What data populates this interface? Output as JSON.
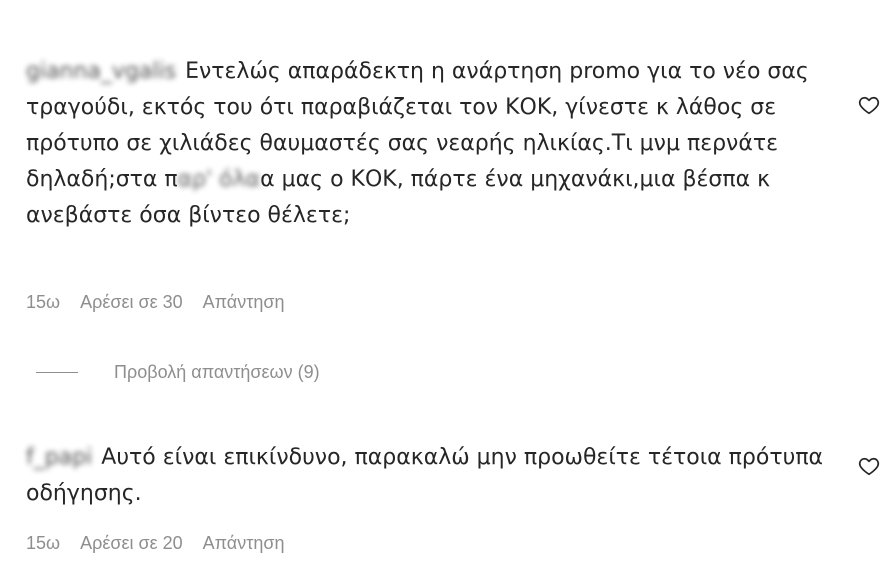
{
  "comments": [
    {
      "username": "gianna_vgalis",
      "text_before": "Εντελώς απαράδεκτη η ανάρτηση promo για το νέο σας τραγούδι, εκτός του ότι παραβιάζεται τον ΚΟΚ, γίνεστε κ λάθος σε πρότυπο σε χιλιάδες θαυμαστές σας νεαρής ηλικίας.Τι μνμ περνάτε δηλαδή;στα π",
      "text_redacted": "αρ' όλα",
      "text_after": "α μας ο ΚΟΚ, πάρτε ένα μηχανάκι,μια βέσπα κ ανεβάστε όσα βίντεο θέλετε;",
      "time": "15ω",
      "likes": "Αρέσει σε 30",
      "reply": "Απάντηση",
      "heart_icon": "heart-outline-icon"
    },
    {
      "username": "f_papi",
      "text_before": "Αυτό είναι επικίνδυνο, παρακαλώ μην προωθείτε τέτοια πρότυπα οδήγησης.",
      "time": "15ω",
      "likes": "Αρέσει σε 20",
      "reply": "Απάντηση",
      "heart_icon": "heart-outline-icon"
    }
  ],
  "view_replies": {
    "label": "Προβολή απαντήσεων (9)"
  },
  "colors": {
    "text": "#262626",
    "secondary": "#8e8e8e",
    "background": "#ffffff"
  }
}
